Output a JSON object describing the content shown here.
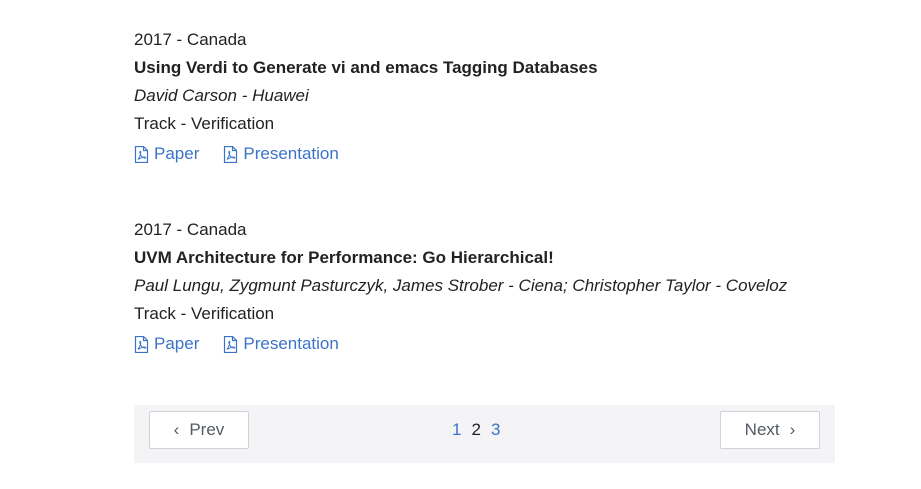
{
  "entries": [
    {
      "meta": "2017 - Canada",
      "title": "Using Verdi to Generate vi and emacs Tagging Databases",
      "authors": "David Carson - Huawei",
      "track": "Track - Verification",
      "paper_label": "Paper",
      "presentation_label": "Presentation"
    },
    {
      "meta": "2017 - Canada",
      "title": "UVM Architecture for Performance: Go Hierarchical!",
      "authors": "Paul Lungu, Zygmunt Pasturczyk, James Strober - Ciena; Christopher Taylor - Coveloz",
      "track": "Track - Verification",
      "paper_label": "Paper",
      "presentation_label": "Presentation"
    }
  ],
  "pagination": {
    "prev_label": "Prev",
    "next_label": "Next",
    "pages": [
      "1",
      "2",
      "3"
    ],
    "current_page": "2"
  },
  "icons": {
    "link_icon": "pdf-file-icon",
    "prev_icon": "chevron-left-icon",
    "next_icon": "chevron-right-icon"
  },
  "colors": {
    "link": "#3b73c8",
    "text": "#222222",
    "pager_bg": "#f4f4f6"
  }
}
